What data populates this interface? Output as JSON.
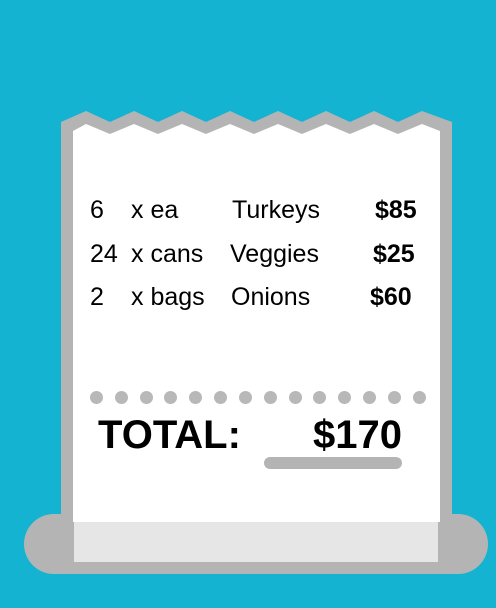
{
  "receipt": {
    "items": [
      {
        "qty": "6",
        "unit": "x ea",
        "name": "Turkeys",
        "price": "$85"
      },
      {
        "qty": "24",
        "unit": "x cans",
        "name": "Veggies",
        "price": "$25"
      },
      {
        "qty": "2",
        "unit": "x bags",
        "name": "Onions",
        "price": "$60"
      }
    ],
    "total_label": "TOTAL:",
    "total_value": "$170"
  },
  "colors": {
    "background": "#14b3d2",
    "receipt_paper": "#ffffff",
    "receipt_border": "#b4b4b4",
    "accent_gray": "#b8b8b8"
  }
}
